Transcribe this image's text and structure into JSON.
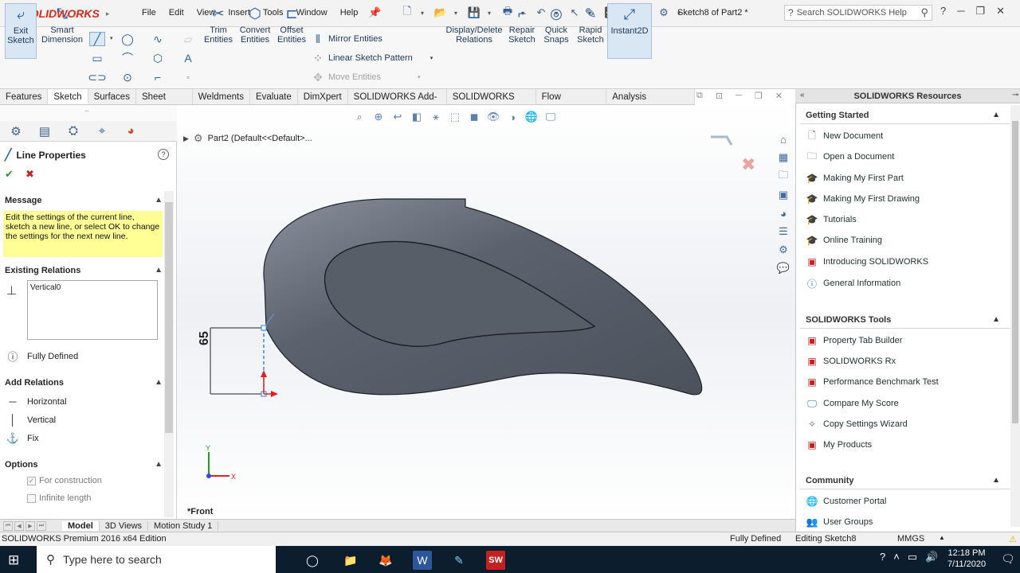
{
  "app": {
    "brand_ds": "3S",
    "brand_name": "SOLIDWORKS",
    "doc_title": "Sketch8 of Part2 *",
    "search_placeholder": "Search SOLIDWORKS Help"
  },
  "menu": [
    "File",
    "Edit",
    "View",
    "Insert",
    "Tools",
    "Window",
    "Help"
  ],
  "commands": {
    "exit_sketch": "Exit\nSketch",
    "smart_dimension": "Smart\nDimension",
    "trim": "Trim\nEntities",
    "convert": "Convert\nEntities",
    "offset": "Offset\nEntities",
    "mirror": "Mirror Entities",
    "linear_pattern": "Linear Sketch Pattern",
    "move": "Move Entities",
    "relations": "Display/Delete\nRelations",
    "repair": "Repair\nSketch",
    "quick_snaps": "Quick\nSnaps",
    "rapid_sketch": "Rapid\nSketch",
    "instant2d": "Instant2D"
  },
  "tabs": [
    "Features",
    "Sketch",
    "Surfaces",
    "Sheet Metal",
    "Weldments",
    "Evaluate",
    "DimXpert",
    "SOLIDWORKS Add-Ins",
    "SOLIDWORKS MBD",
    "Flow Simulation",
    "Analysis Preparation"
  ],
  "active_tab": "Sketch",
  "property_manager": {
    "title": "Line Properties",
    "message_header": "Message",
    "message": "Edit the settings of the current line, sketch a new line, or select OK to change the settings for the next new line.",
    "existing_relations_header": "Existing Relations",
    "relations": [
      "Vertical0"
    ],
    "status": "Fully Defined",
    "add_relations_header": "Add Relations",
    "add_relations": [
      "Horizontal",
      "Vertical",
      "Fix"
    ],
    "options_header": "Options",
    "options": [
      {
        "label": "For construction",
        "checked": true
      },
      {
        "label": "Infinite length",
        "checked": false
      }
    ]
  },
  "graphics": {
    "tree_label": "Part2  (Default<<Default>...",
    "view_label": "*Front",
    "dimension": "65"
  },
  "task_pane": {
    "title": "SOLIDWORKS Resources",
    "getting_started_header": "Getting Started",
    "getting_started": [
      "New Document",
      "Open a Document",
      "Making My First Part",
      "Making My First Drawing",
      "Tutorials",
      "Online Training",
      "Introducing SOLIDWORKS",
      "General Information"
    ],
    "tools_header": "SOLIDWORKS Tools",
    "tools": [
      "Property Tab Builder",
      "SOLIDWORKS Rx",
      "Performance Benchmark Test",
      "Compare My Score",
      "Copy Settings Wizard",
      "My Products"
    ],
    "community_header": "Community",
    "community": [
      "Customer Portal",
      "User Groups"
    ]
  },
  "bottom_tabs": [
    "Model",
    "3D Views",
    "Motion Study 1"
  ],
  "active_bottom_tab": "Model",
  "status_bar": {
    "edition": "SOLIDWORKS Premium 2016 x64 Edition",
    "defined": "Fully Defined",
    "editing": "Editing Sketch8",
    "units": "MMGS"
  },
  "taskbar": {
    "search": "Type here to search",
    "time": "12:18 PM",
    "date": "7/11/2020"
  },
  "colors": {
    "accent": "#d52b1e",
    "message_bg": "#ffff95",
    "part": "#5e6470"
  }
}
